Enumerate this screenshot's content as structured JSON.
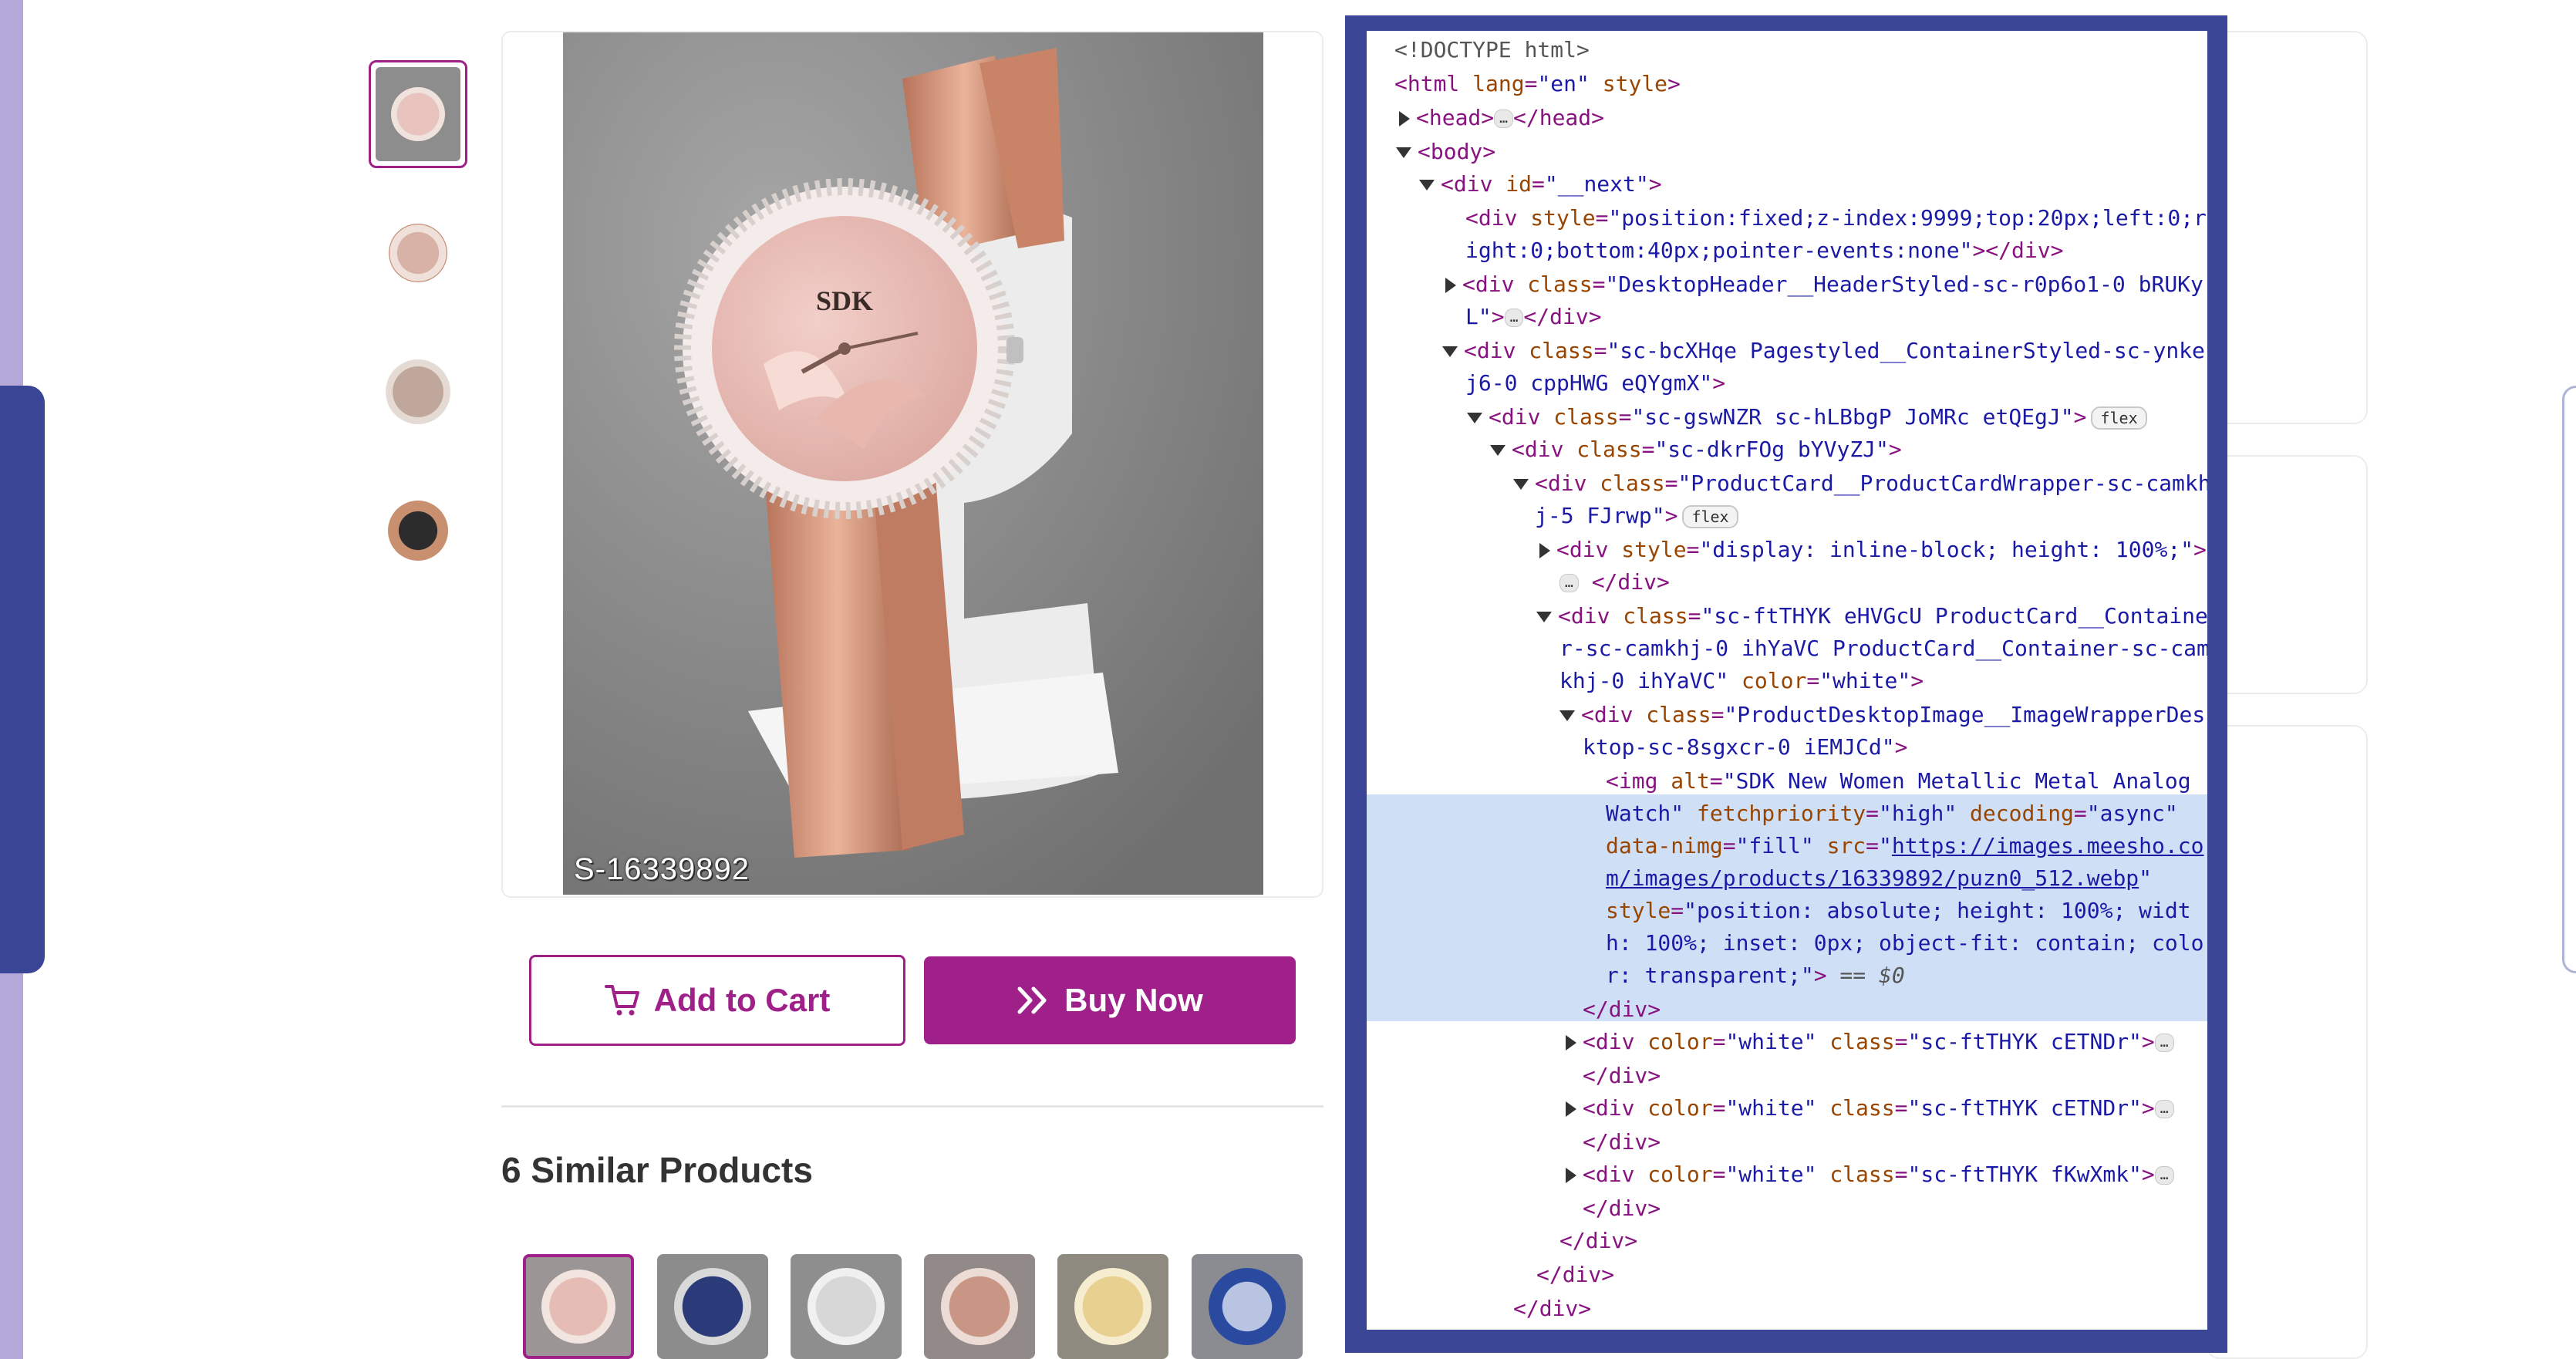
{
  "product": {
    "image_alt": "SDK New Women Metallic Metal Analog Watch",
    "image_watermark": "S-16339892",
    "brand_mark": "SDK",
    "add_to_cart_label": "Add to Cart",
    "buy_now_label": "Buy Now",
    "similar_title": "6 Similar Products",
    "thumbnails": [
      "front",
      "angle",
      "dimensions",
      "back"
    ],
    "similar_products": [
      "rose-gold",
      "navy",
      "silver",
      "bronze",
      "gold",
      "blue"
    ]
  },
  "colors": {
    "accent": "#9f2089",
    "devtools_frame": "#3b4595",
    "selection": "#cfe0f6"
  },
  "devtools": {
    "l1": "<!DOCTYPE html>",
    "l2_tag": "<html",
    "l2_attr": "lang",
    "l2_val": "\"en\"",
    "l2_attr2": "style",
    "l2_end": ">",
    "l3_open": "<head>",
    "l3_close": "</head>",
    "l4": "<body>",
    "l5_tag": "<div",
    "l5_attr": "id",
    "l5_val": "\"__next\"",
    "l5_end": ">",
    "l6_tag": "<div",
    "l6_attr": "style",
    "l6_val": "\"position:fixed;z-index:9999;top:20px;left:0;r",
    "l7_val": "ight:0;bottom:40px;pointer-events:none\"",
    "l7_end": "></div>",
    "l8_tag": "<div",
    "l8_attr": "class",
    "l8_val": "\"DesktopHeader__HeaderStyled-sc-r0p6o1-0 bRUKy",
    "l9_val": "L\"",
    "l9_end_a": ">",
    "l9_end_b": "</div>",
    "l10_tag": "<div",
    "l10_attr": "class",
    "l10_val": "\"sc-bcXHqe Pagestyled__ContainerStyled-sc-ynke",
    "l11_val": "j6-0 cppHWG eQYgmX\"",
    "l11_end": ">",
    "l12_tag": "<div",
    "l12_attr": "class",
    "l12_val": "\"sc-gswNZR sc-hLBbgP JoMRc etQEgJ\"",
    "l12_end": ">",
    "badge_flex": "flex",
    "l13_tag": "<div",
    "l13_attr": "class",
    "l13_val": "\"sc-dkrFOg bYVyZJ\"",
    "l13_end": ">",
    "l14_tag": "<div",
    "l14_attr": "class",
    "l14_val": "\"ProductCard__ProductCardWrapper-sc-camkh",
    "l15_val": "j-5 FJrwp\"",
    "l15_end": ">",
    "l16_tag": "<div",
    "l16_attr": "style",
    "l16_val": "\"display: inline-block; height: 100%;\"",
    "l16_end": ">",
    "l17_end": "</div>",
    "l18_tag": "<div",
    "l18_attr": "class",
    "l18_val": "\"sc-ftTHYK eHVGcU ProductCard__Containe",
    "l19_val": "r-sc-camkhj-0 ihYaVC ProductCard__Container-sc-cam",
    "l20_val": "khj-0 ihYaVC\"",
    "l20_attr": "color",
    "l20_val2": "\"white\"",
    "l20_end": ">",
    "l21_tag": "<div",
    "l21_attr": "class",
    "l21_val": "\"ProductDesktopImage__ImageWrapperDes",
    "l22_val": "ktop-sc-8sgxcr-0 iEMJCd\"",
    "l22_end": ">",
    "l23_tag": "<img",
    "l23_attr": "alt",
    "l23_val": "\"SDK New Women Metallic Metal Analog",
    "l24_val": "Watch\"",
    "l24_attr": "fetchpriority",
    "l24_val2": "\"high\"",
    "l24_attr2": "decoding",
    "l24_val3": "\"async\"",
    "l25_attr": "data-nimg",
    "l25_val": "\"fill\"",
    "l25_attr2": "src",
    "l25_q": "\"",
    "l25_link": "https://images.meesho.co",
    "l26_link": "m/images/products/16339892/puzn0_512.webp",
    "l26_q": "\"",
    "l27_attr": "style",
    "l27_val": "\"position: absolute; height: 100%; widt",
    "l28_val": "h: 100%; inset: 0px; object-fit: contain; colo",
    "l29_val": "r: transparent;\"",
    "l29_end": ">",
    "l29_eq": " == $0",
    "l30": "</div>",
    "l31_tag": "<div",
    "l31_attr": "color",
    "l31_val": "\"white\"",
    "l31_attr2": "class",
    "l31_val2": "\"sc-ftTHYK cETNDr\"",
    "l31_end": ">",
    "l32": "</div>",
    "l33_tag": "<div",
    "l33_attr": "color",
    "l33_val": "\"white\"",
    "l33_attr2": "class",
    "l33_val2": "\"sc-ftTHYK cETNDr\"",
    "l33_end": ">",
    "l34": "</div>",
    "l35_tag": "<div",
    "l35_attr": "color",
    "l35_val": "\"white\"",
    "l35_attr2": "class",
    "l35_val2": "\"sc-ftTHYK fKwXmk\"",
    "l35_end": ">",
    "l36": "</div>",
    "l37": "</div>",
    "l38": "</div>",
    "l39": "</div>",
    "ellipsis": "…",
    "dots": "..."
  }
}
